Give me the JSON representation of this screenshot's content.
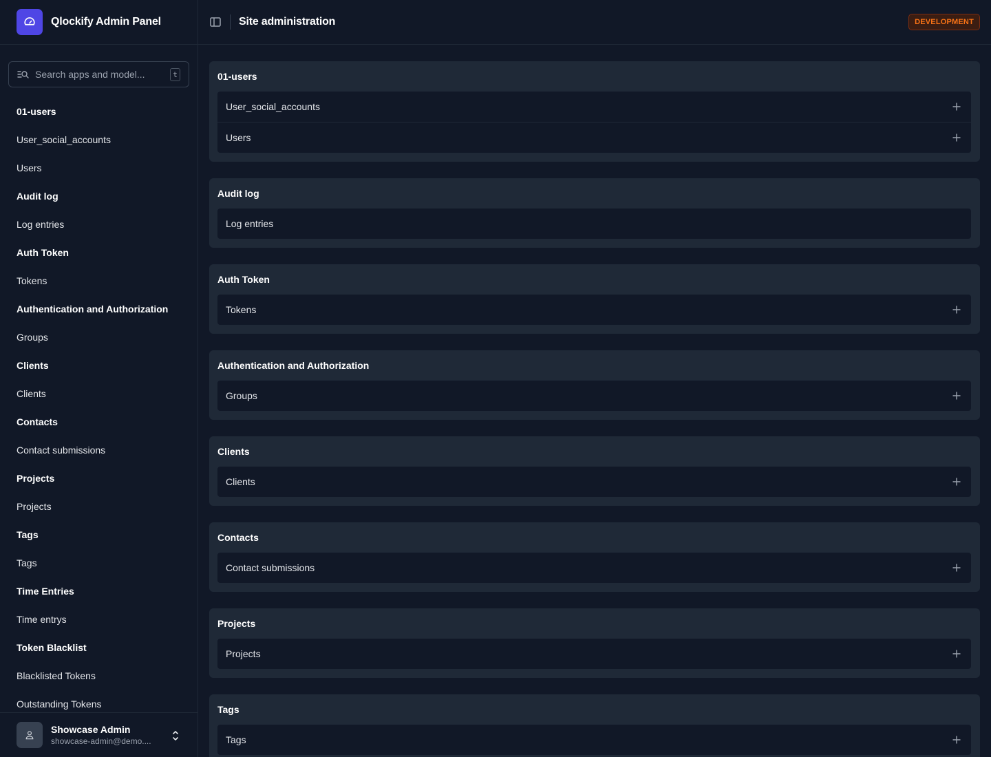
{
  "brand": {
    "title": "Qlockify Admin Panel"
  },
  "search": {
    "placeholder": "Search apps and model...",
    "shortcut": "t"
  },
  "header": {
    "title": "Site administration",
    "env_badge": "DEVELOPMENT"
  },
  "sidebar": {
    "groups": [
      {
        "title": "01-users",
        "items": [
          "User_social_accounts",
          "Users"
        ]
      },
      {
        "title": "Audit log",
        "items": [
          "Log entries"
        ]
      },
      {
        "title": "Auth Token",
        "items": [
          "Tokens"
        ]
      },
      {
        "title": "Authentication and Authorization",
        "items": [
          "Groups"
        ]
      },
      {
        "title": "Clients",
        "items": [
          "Clients"
        ]
      },
      {
        "title": "Contacts",
        "items": [
          "Contact submissions"
        ]
      },
      {
        "title": "Projects",
        "items": [
          "Projects"
        ]
      },
      {
        "title": "Tags",
        "items": [
          "Tags"
        ]
      },
      {
        "title": "Time Entries",
        "items": [
          "Time entrys"
        ]
      },
      {
        "title": "Token Blacklist",
        "items": [
          "Blacklisted Tokens",
          "Outstanding Tokens"
        ]
      }
    ]
  },
  "user": {
    "name": "Showcase Admin",
    "email": "showcase-admin@demo...."
  },
  "modules": [
    {
      "title": "01-users",
      "models": [
        {
          "name": "User_social_accounts",
          "add": true
        },
        {
          "name": "Users",
          "add": true
        }
      ]
    },
    {
      "title": "Audit log",
      "models": [
        {
          "name": "Log entries",
          "add": false
        }
      ]
    },
    {
      "title": "Auth Token",
      "models": [
        {
          "name": "Tokens",
          "add": true
        }
      ]
    },
    {
      "title": "Authentication and Authorization",
      "models": [
        {
          "name": "Groups",
          "add": true
        }
      ]
    },
    {
      "title": "Clients",
      "models": [
        {
          "name": "Clients",
          "add": true
        }
      ]
    },
    {
      "title": "Contacts",
      "models": [
        {
          "name": "Contact submissions",
          "add": true
        }
      ]
    },
    {
      "title": "Projects",
      "models": [
        {
          "name": "Projects",
          "add": true
        }
      ]
    },
    {
      "title": "Tags",
      "models": [
        {
          "name": "Tags",
          "add": true
        }
      ]
    }
  ],
  "colors": {
    "accent": "#4f46e5",
    "badge": "#f97316",
    "background": "#111827",
    "panel": "#1f2937"
  }
}
